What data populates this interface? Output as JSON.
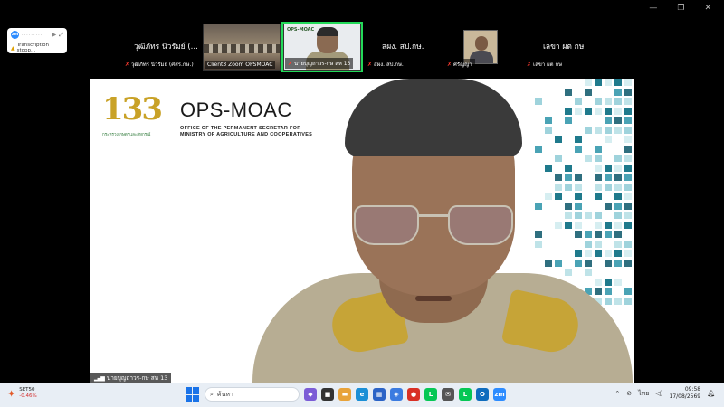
{
  "window": {
    "minimize": "—",
    "maximize": "❐",
    "close": "✕"
  },
  "transcription": {
    "zoom_badge": "zm",
    "dots": "·········",
    "status": "Transcription stopp..."
  },
  "participants": [
    {
      "id": "p1",
      "big_name": "วุฒิภัทร นิวรัมย์ (...",
      "label": "วุฒิภัทร นิวรัมย์ (ศสร.กษ.)",
      "type": "name"
    },
    {
      "id": "p2",
      "label": "Client3 Zoom OPSMOAC",
      "type": "video"
    },
    {
      "id": "p3",
      "label": "นายบุญถาวร-กษ สห 13",
      "type": "video",
      "thumb_logo": "OPS-MOAC",
      "active": true
    },
    {
      "id": "p4",
      "big_name": "สผง. สป.กษ.",
      "label": "สผง. สป.กษ.",
      "type": "name"
    },
    {
      "id": "p5",
      "label": "ศรัญญา",
      "type": "avatar"
    },
    {
      "id": "p6",
      "big_name": "เลขา ผต กษ",
      "label": "เลขา ผต กษ",
      "type": "name"
    }
  ],
  "main": {
    "logo_number": "133",
    "logo_sub": "กระทรวงเกษตรและสหกรณ์",
    "ops_title": "OPS-MOAC",
    "ops_sub1": "OFFICE OF THE PERMANENT SECRETAR FOR",
    "ops_sub2": "MINISTRY OF AGRICULTURE AND COOPERATIVES",
    "name_tag": "นายบุญถาวร-กษ สห 13",
    "mosaic_colors": [
      "#1f7a8c",
      "#4aa3b5",
      "#9fd3dc",
      "#d6eef1",
      "#2f6f7f",
      "#bfe3e8"
    ]
  },
  "taskbar": {
    "weather_ticker": "SET50",
    "weather_change": "-0.46%",
    "search_placeholder": "ค้นหา",
    "apps": [
      {
        "name": "copilot-icon",
        "color": "#7b5cd6",
        "glyph": "◆"
      },
      {
        "name": "file-explorer-icon",
        "color": "#333333",
        "glyph": "■"
      },
      {
        "name": "folder-icon",
        "color": "#e8a33a",
        "glyph": "▬"
      },
      {
        "name": "edge-icon",
        "color": "#1b8fd6",
        "glyph": "e"
      },
      {
        "name": "store-icon",
        "color": "#2b63c6",
        "glyph": "▦"
      },
      {
        "name": "vpn-icon",
        "color": "#3b7be0",
        "glyph": "◈"
      },
      {
        "name": "chrome-icon",
        "color": "#d93025",
        "glyph": "●"
      },
      {
        "name": "line-icon",
        "color": "#06c755",
        "glyph": "L"
      },
      {
        "name": "mail-icon",
        "color": "#555555",
        "glyph": "✉"
      },
      {
        "name": "line2-icon",
        "color": "#06c755",
        "glyph": "L"
      },
      {
        "name": "outlook-icon",
        "color": "#0f6cbd",
        "glyph": "O"
      },
      {
        "name": "zoom-icon",
        "color": "#2d8cff",
        "glyph": "zm"
      }
    ],
    "lang": "ไทย",
    "time": "09:58",
    "date": "17/08/2569"
  }
}
